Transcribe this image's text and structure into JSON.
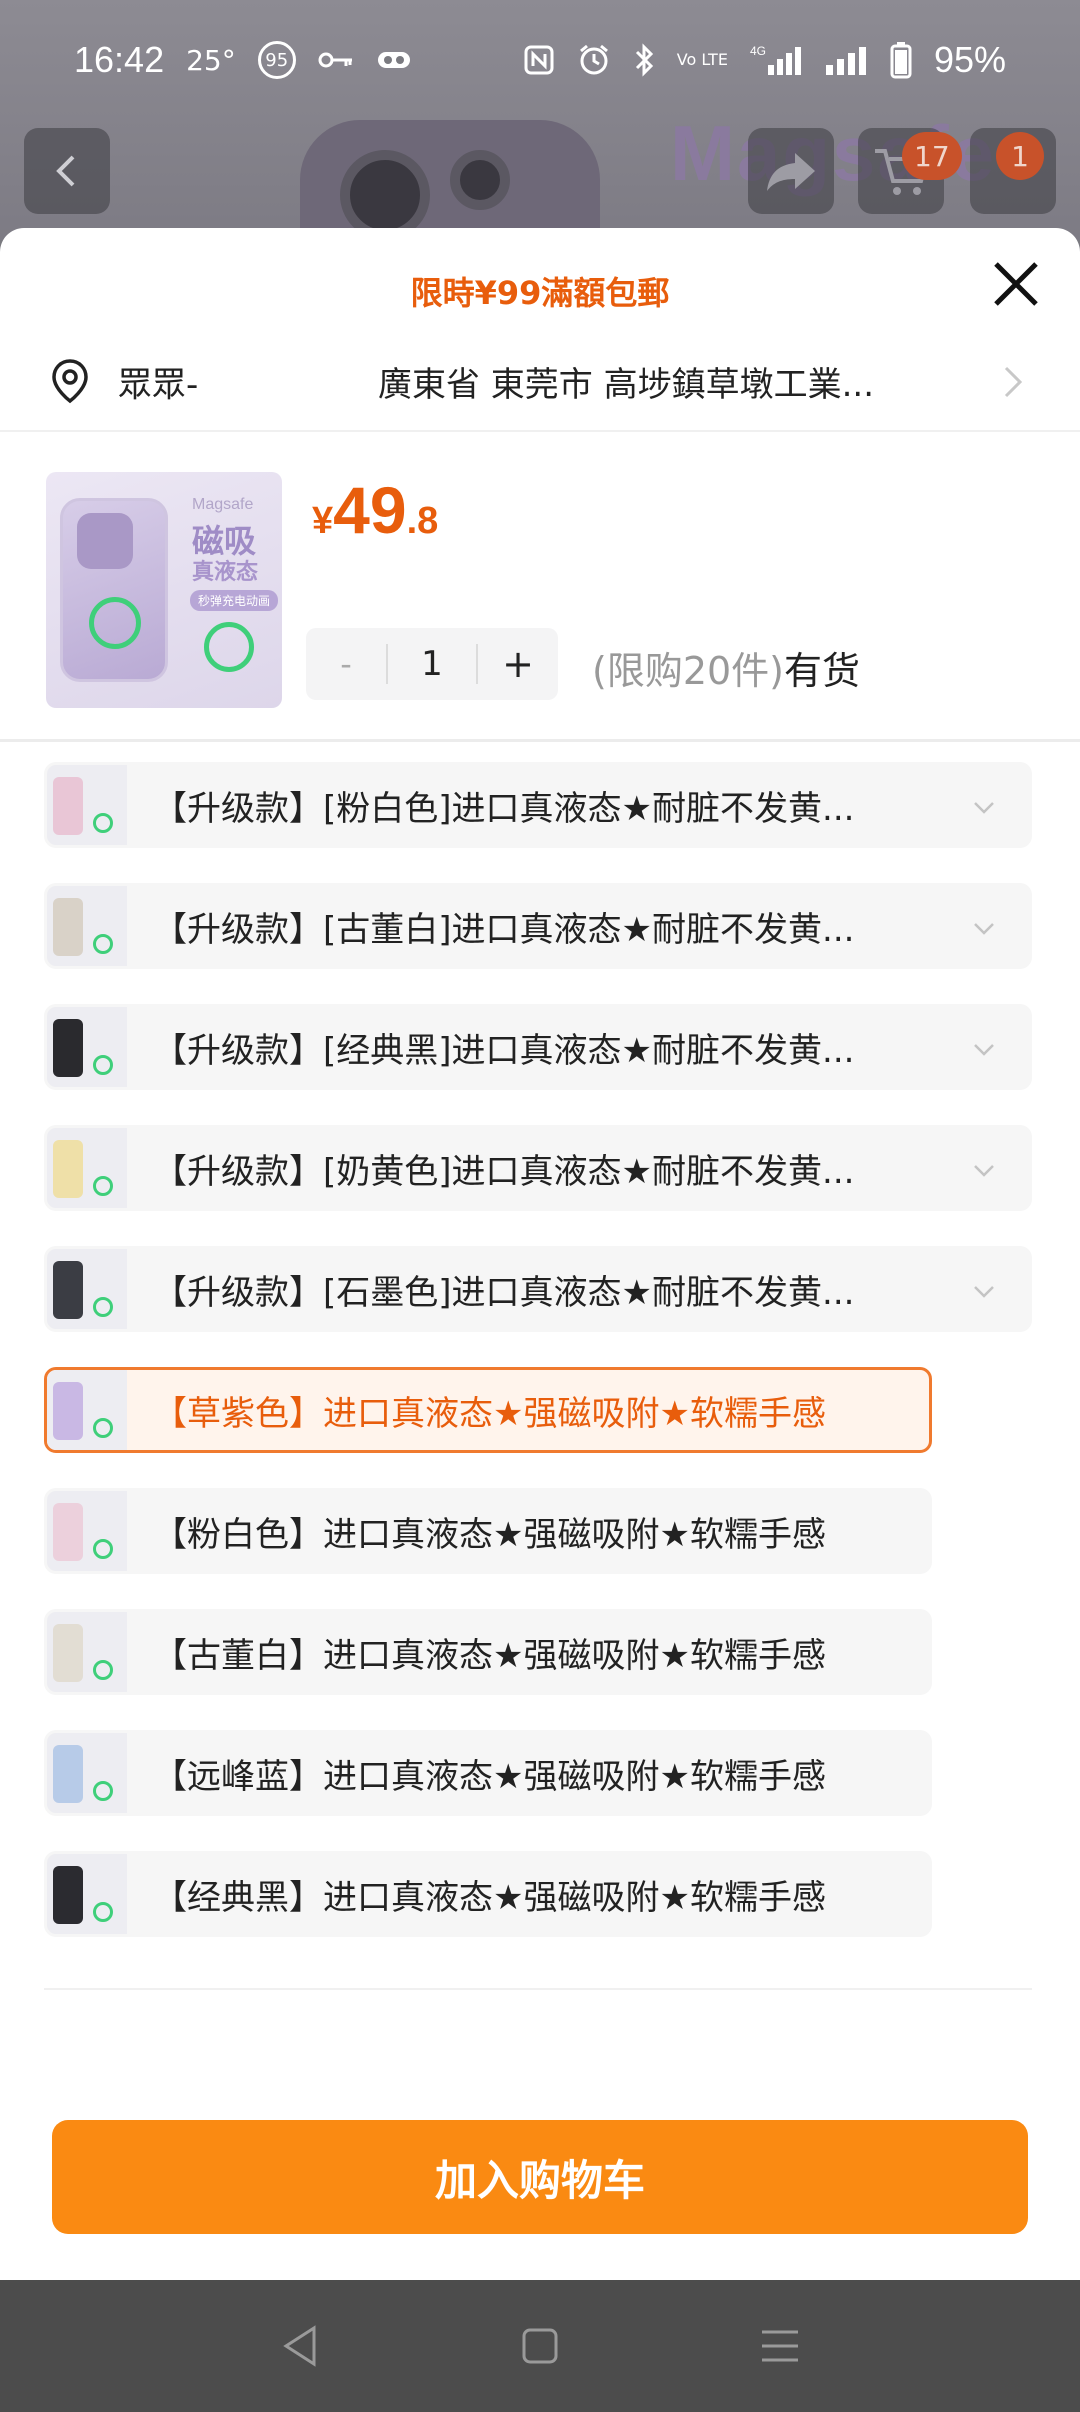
{
  "status_bar": {
    "time": "16:42",
    "temperature": "25°",
    "aqi": "95",
    "network": "4G",
    "vo_lte": "Vo LTE",
    "battery": "95%"
  },
  "background": {
    "brand_text": "Magsafe",
    "cart_badge": "17",
    "message_badge": "1"
  },
  "sheet": {
    "promo": "限時¥99滿額包郵",
    "address": {
      "name": "眾眾-",
      "detail": "廣東省 東莞市 高埗鎮草墩工業..."
    },
    "product": {
      "currency": "¥",
      "price_int": "49",
      "price_dec": ".8",
      "quantity": "1",
      "minus_label": "-",
      "plus_label": "+",
      "limit": "(限购20件)",
      "stock": "有货",
      "thumb": {
        "brand": "Magsafe",
        "line1": "磁吸",
        "line2": "真液态",
        "tag": "秒弹充电动画"
      }
    },
    "variants": [
      {
        "label": "【升级款】[粉白色]进口真液态★耐脏不发黄...",
        "has_chevron": true,
        "selected": false,
        "color": "#e9c6d6"
      },
      {
        "label": "【升级款】[古董白]进口真液态★耐脏不发黄...",
        "has_chevron": true,
        "selected": false,
        "color": "#d9d2c8"
      },
      {
        "label": "【升级款】[经典黑]进口真液态★耐脏不发黄...",
        "has_chevron": true,
        "selected": false,
        "color": "#2a2a2e"
      },
      {
        "label": "【升级款】[奶黄色]进口真液态★耐脏不发黄...",
        "has_chevron": true,
        "selected": false,
        "color": "#efe0a8"
      },
      {
        "label": "【升级款】[石墨色]进口真液态★耐脏不发黄...",
        "has_chevron": true,
        "selected": false,
        "color": "#3b3d44"
      },
      {
        "label": "【草紫色】进口真液态★强磁吸附★软糯手感",
        "has_chevron": false,
        "selected": true,
        "color": "#c9b8e4"
      },
      {
        "label": "【粉白色】进口真液态★强磁吸附★软糯手感",
        "has_chevron": false,
        "selected": false,
        "color": "#ecd0dc"
      },
      {
        "label": "【古董白】进口真液态★强磁吸附★软糯手感",
        "has_chevron": false,
        "selected": false,
        "color": "#e2ddd3"
      },
      {
        "label": "【远峰蓝】进口真液态★强磁吸附★软糯手感",
        "has_chevron": false,
        "selected": false,
        "color": "#b7cbe8"
      },
      {
        "label": "【经典黑】进口真液态★强磁吸附★软糯手感",
        "has_chevron": false,
        "selected": false,
        "color": "#2b2b30"
      }
    ],
    "add_to_cart": "加入购物车"
  },
  "colors": {
    "accent": "#e85d0c",
    "button": "#fa8a12",
    "nav_bar": "#4c4c4c"
  }
}
